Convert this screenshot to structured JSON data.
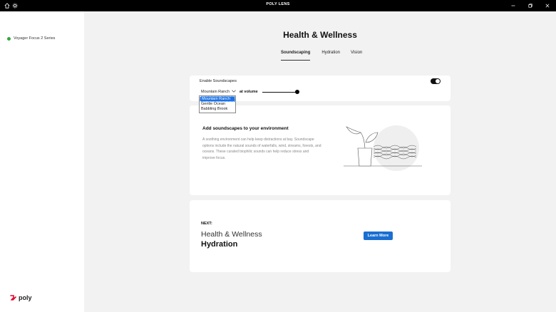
{
  "titlebar": {
    "app_title": "POLY LENS",
    "icons": [
      "home-icon",
      "gear-icon"
    ],
    "window_controls": [
      "minimize-icon",
      "maximize-icon",
      "close-icon"
    ]
  },
  "sidebar": {
    "device": {
      "name": "Voyager Focus 2 Series",
      "status_color": "#2eaa3c"
    },
    "brand": "poly"
  },
  "main": {
    "title": "Health & Wellness",
    "tabs": [
      {
        "label": "Soundscaping",
        "active": true
      },
      {
        "label": "Hydration",
        "active": false
      },
      {
        "label": "Vision",
        "active": false
      }
    ],
    "soundscape": {
      "enable_label": "Enable Soundscapes",
      "enabled": true,
      "selected": "Mountain Ranch",
      "volume_label": "at volume",
      "options": [
        "Mountain Ranch",
        "Gentle Ocean",
        "Babbling Brook"
      ]
    },
    "info_card": {
      "heading": "Add soundscapes to your environment",
      "description": "A soothing environment can help keep distractions at bay. Soundscape options include the natural sounds of waterfalls, wind, streams, forests, and oceans. These curated biophilic sounds can help reduce stress and improve focus."
    },
    "next_card": {
      "label": "NEXT:",
      "line1": "Health & Wellness",
      "line2": "Hydration",
      "button": "Learn More"
    }
  },
  "colors": {
    "accent": "#1a6fd1",
    "background": "#f2f2f2",
    "titlebar": "#000000"
  }
}
